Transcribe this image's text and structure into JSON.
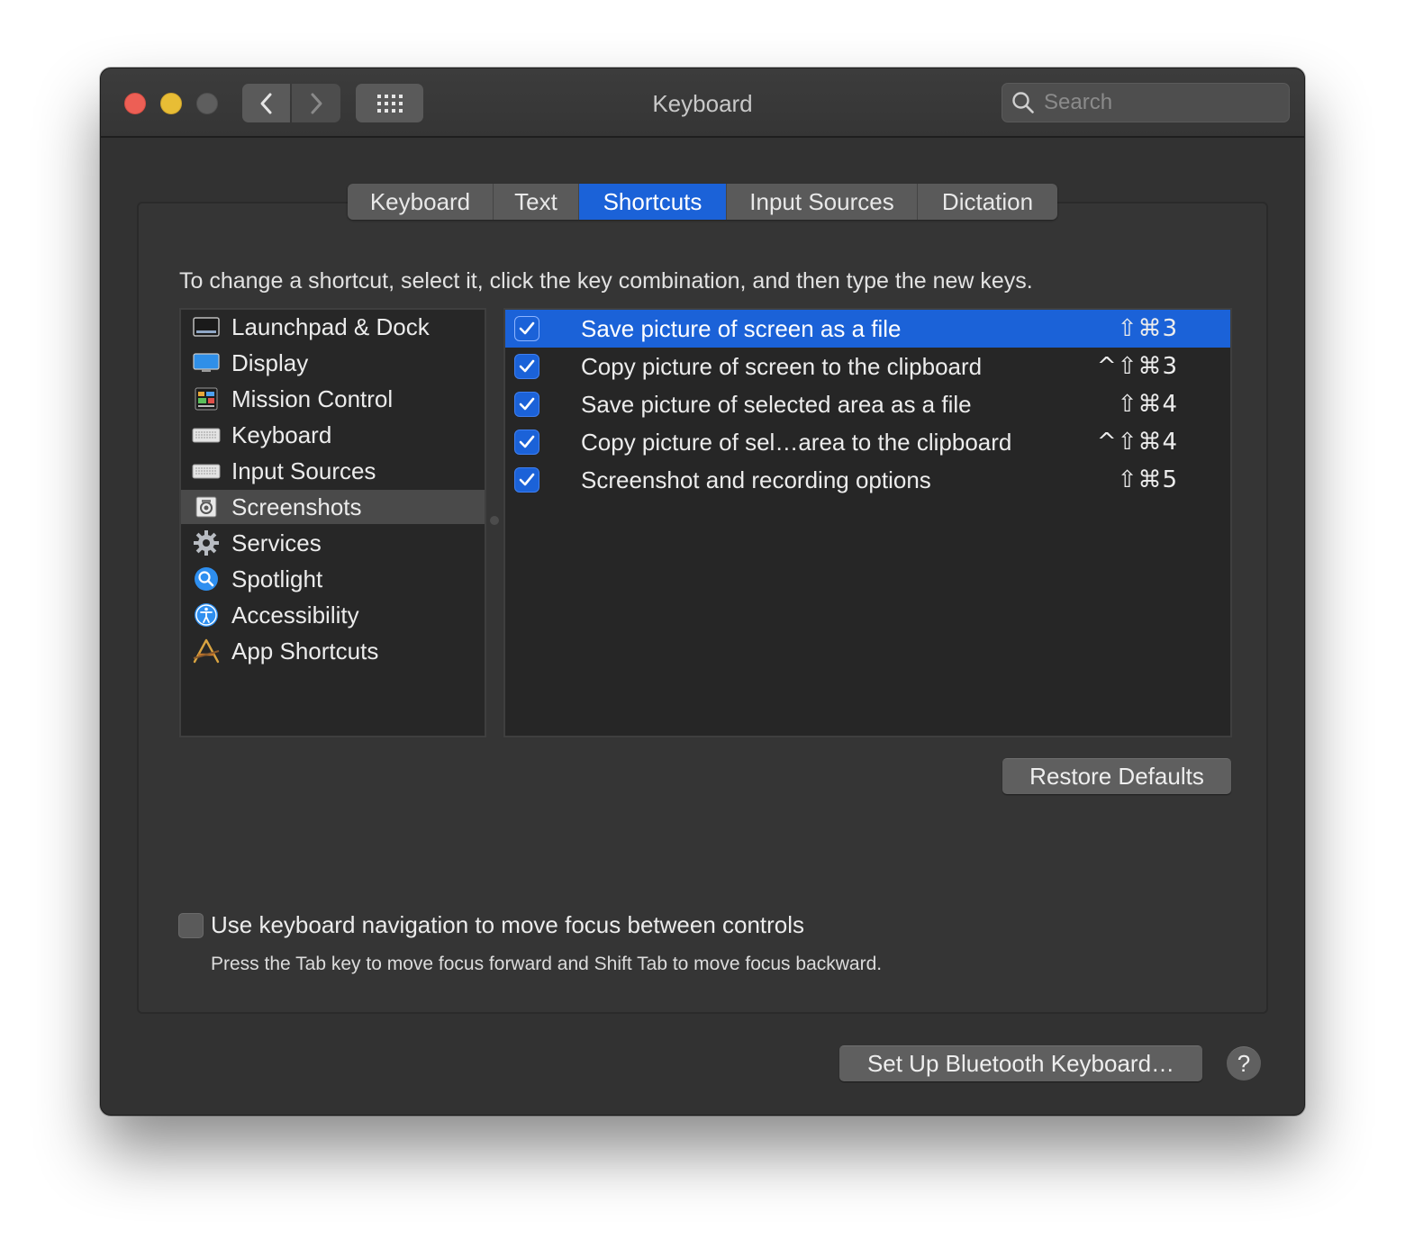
{
  "window": {
    "title": "Keyboard"
  },
  "search": {
    "placeholder": "Search"
  },
  "tabs": [
    {
      "label": "Keyboard",
      "active": false
    },
    {
      "label": "Text",
      "active": false
    },
    {
      "label": "Shortcuts",
      "active": true
    },
    {
      "label": "Input Sources",
      "active": false
    },
    {
      "label": "Dictation",
      "active": false
    }
  ],
  "instruction": "To change a shortcut, select it, click the key combination, and then type the new keys.",
  "categories": [
    {
      "label": "Launchpad & Dock",
      "icon": "launchpad-dock-icon"
    },
    {
      "label": "Display",
      "icon": "display-icon"
    },
    {
      "label": "Mission Control",
      "icon": "mission-control-icon"
    },
    {
      "label": "Keyboard",
      "icon": "keyboard-icon"
    },
    {
      "label": "Input Sources",
      "icon": "input-sources-icon"
    },
    {
      "label": "Screenshots",
      "icon": "screenshots-icon",
      "selected": true
    },
    {
      "label": "Services",
      "icon": "gear-icon"
    },
    {
      "label": "Spotlight",
      "icon": "spotlight-icon"
    },
    {
      "label": "Accessibility",
      "icon": "accessibility-icon"
    },
    {
      "label": "App Shortcuts",
      "icon": "app-shortcuts-icon"
    }
  ],
  "shortcuts": [
    {
      "label": "Save picture of screen as a file",
      "keys": "⇧⌘3",
      "checked": true,
      "selected": true
    },
    {
      "label": "Copy picture of screen to the clipboard",
      "keys": "^⇧⌘3",
      "checked": true
    },
    {
      "label": "Save picture of selected area as a file",
      "keys": "⇧⌘4",
      "checked": true
    },
    {
      "label": "Copy picture of sel…area to the clipboard",
      "keys": "^⇧⌘4",
      "checked": true
    },
    {
      "label": "Screenshot and recording options",
      "keys": "⇧⌘5",
      "checked": true
    }
  ],
  "buttons": {
    "restore_defaults": "Restore Defaults",
    "bluetooth": "Set Up Bluetooth Keyboard…",
    "help": "?"
  },
  "keyboard_navigation": {
    "label": "Use keyboard navigation to move focus between controls",
    "hint": "Press the Tab key to move focus forward and Shift Tab to move focus backward.",
    "checked": false
  },
  "colors": {
    "accent": "#1b62d8",
    "close": "#ed5f55",
    "minimize": "#e8bd35"
  }
}
